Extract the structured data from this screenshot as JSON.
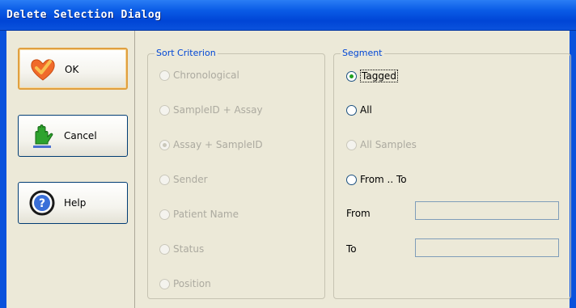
{
  "window": {
    "title": "Delete Selection Dialog"
  },
  "buttons": {
    "ok": "OK",
    "cancel": "Cancel",
    "help": "Help"
  },
  "sort_criterion": {
    "legend": "Sort Criterion",
    "options": [
      "Chronological",
      "SampleID + Assay",
      "Assay + SampleID",
      "Sender",
      "Patient Name",
      "Status",
      "Position"
    ],
    "selected": "Assay + SampleID"
  },
  "segment": {
    "legend": "Segment",
    "options": [
      "Tagged",
      "All",
      "All Samples",
      "From .. To"
    ],
    "selected": "Tagged",
    "from_label": "From",
    "to_label": "To",
    "from_value": "",
    "to_value": ""
  },
  "colors": {
    "titlebar": "#0a52dc",
    "legend": "#0046d5",
    "ok_border": "#e0a040"
  }
}
